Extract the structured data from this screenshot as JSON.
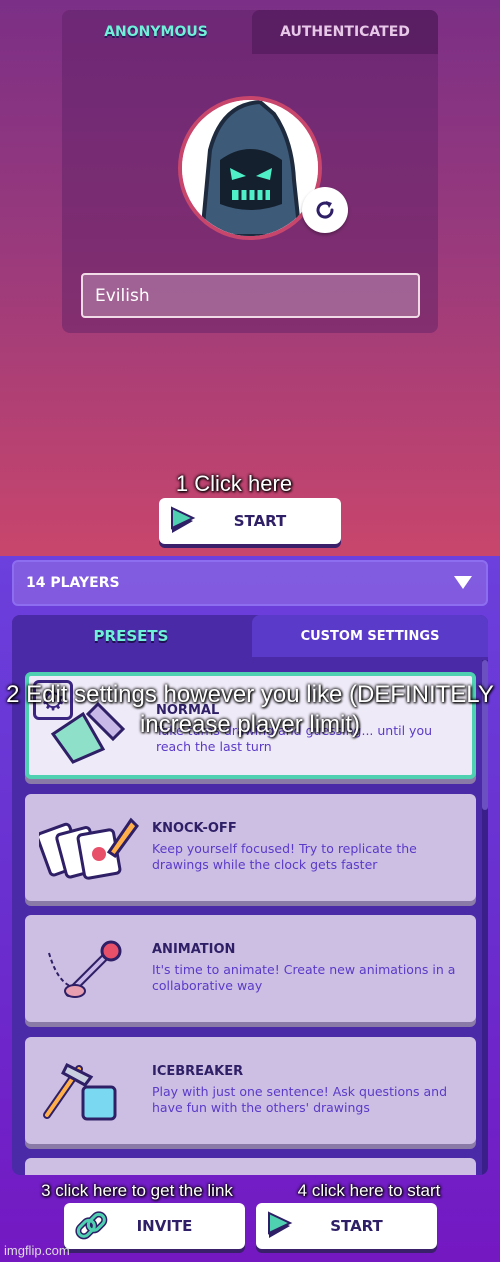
{
  "profile": {
    "tabs": [
      {
        "label": "ANONYMOUS",
        "active": true
      },
      {
        "label": "AUTHENTICATED",
        "active": false
      }
    ],
    "nickname": "Evilish"
  },
  "start_top": {
    "label": "START"
  },
  "players_select": {
    "value": "14 PLAYERS"
  },
  "settings_tabs": [
    {
      "label": "PRESETS",
      "active": true
    },
    {
      "label": "CUSTOM SETTINGS",
      "active": false
    }
  ],
  "presets": [
    {
      "title": "NORMAL",
      "desc": "Take turns drawing and guessing... until you reach the last turn",
      "selected": true
    },
    {
      "title": "KNOCK-OFF",
      "desc": "Keep yourself focused! Try to replicate the drawings while the clock gets faster"
    },
    {
      "title": "ANIMATION",
      "desc": "It's time to animate! Create new animations in a collaborative way"
    },
    {
      "title": "ICEBREAKER",
      "desc": "Play with just one sentence! Ask questions and have fun with the others' drawings"
    }
  ],
  "buttons": {
    "invite": "INVITE",
    "start": "START"
  },
  "annotations": {
    "a1": "1 Click here",
    "a2": "2 Edit settings however you like (DEFINITELY increase player limit)",
    "a3": "3 click here to get the link",
    "a4": "4 click here to start"
  },
  "watermark": "imgflip.com",
  "colors": {
    "accent": "#4fd0b0",
    "text_dark": "#2e1f66",
    "purple": "#6a2fcf"
  }
}
